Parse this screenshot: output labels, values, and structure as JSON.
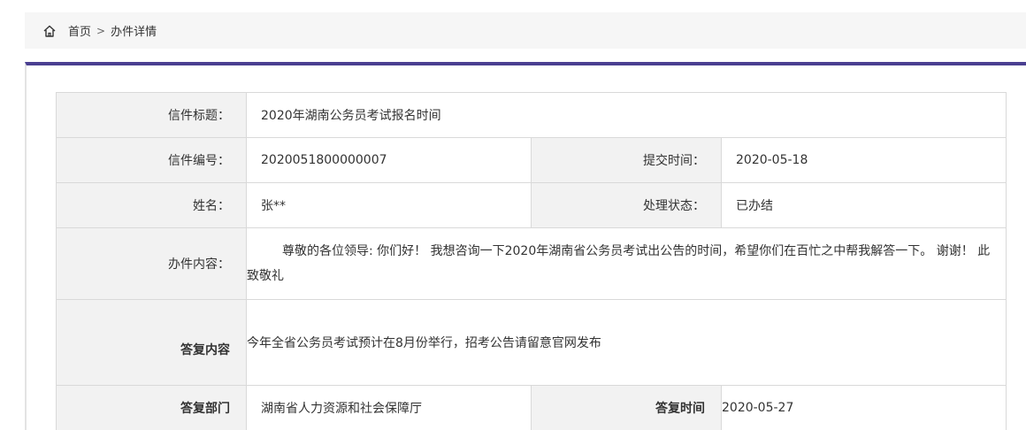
{
  "breadcrumb": {
    "home_label": "首页",
    "separator": ">",
    "current_label": "办件详情"
  },
  "accent_color": "#4a3f91",
  "detail": {
    "title_label": "信件标题：",
    "title_value": "2020年湖南公务员考试报名时间",
    "number_label": "信件编号：",
    "number_value": "2020051800000007",
    "submit_time_label": "提交时间：",
    "submit_time_value": "2020-05-18",
    "name_label": "姓名：",
    "name_value": "张**",
    "status_label": "处理状态：",
    "status_value": "已办结",
    "content_label": "办件内容：",
    "content_value": "尊敬的各位领导: 你们好！ 我想咨询一下2020年湖南省公务员考试出公告的时间，希望你们在百忙之中帮我解答一下。 谢谢！ 此致敬礼",
    "reply_label": "答复内容",
    "reply_value": "今年全省公务员考试预计在8月份举行，招考公告请留意官网发布",
    "reply_dept_label": "答复部门",
    "reply_dept_value": "湖南省人力资源和社会保障厅",
    "reply_time_label": "答复时间",
    "reply_time_value": "2020-05-27"
  }
}
